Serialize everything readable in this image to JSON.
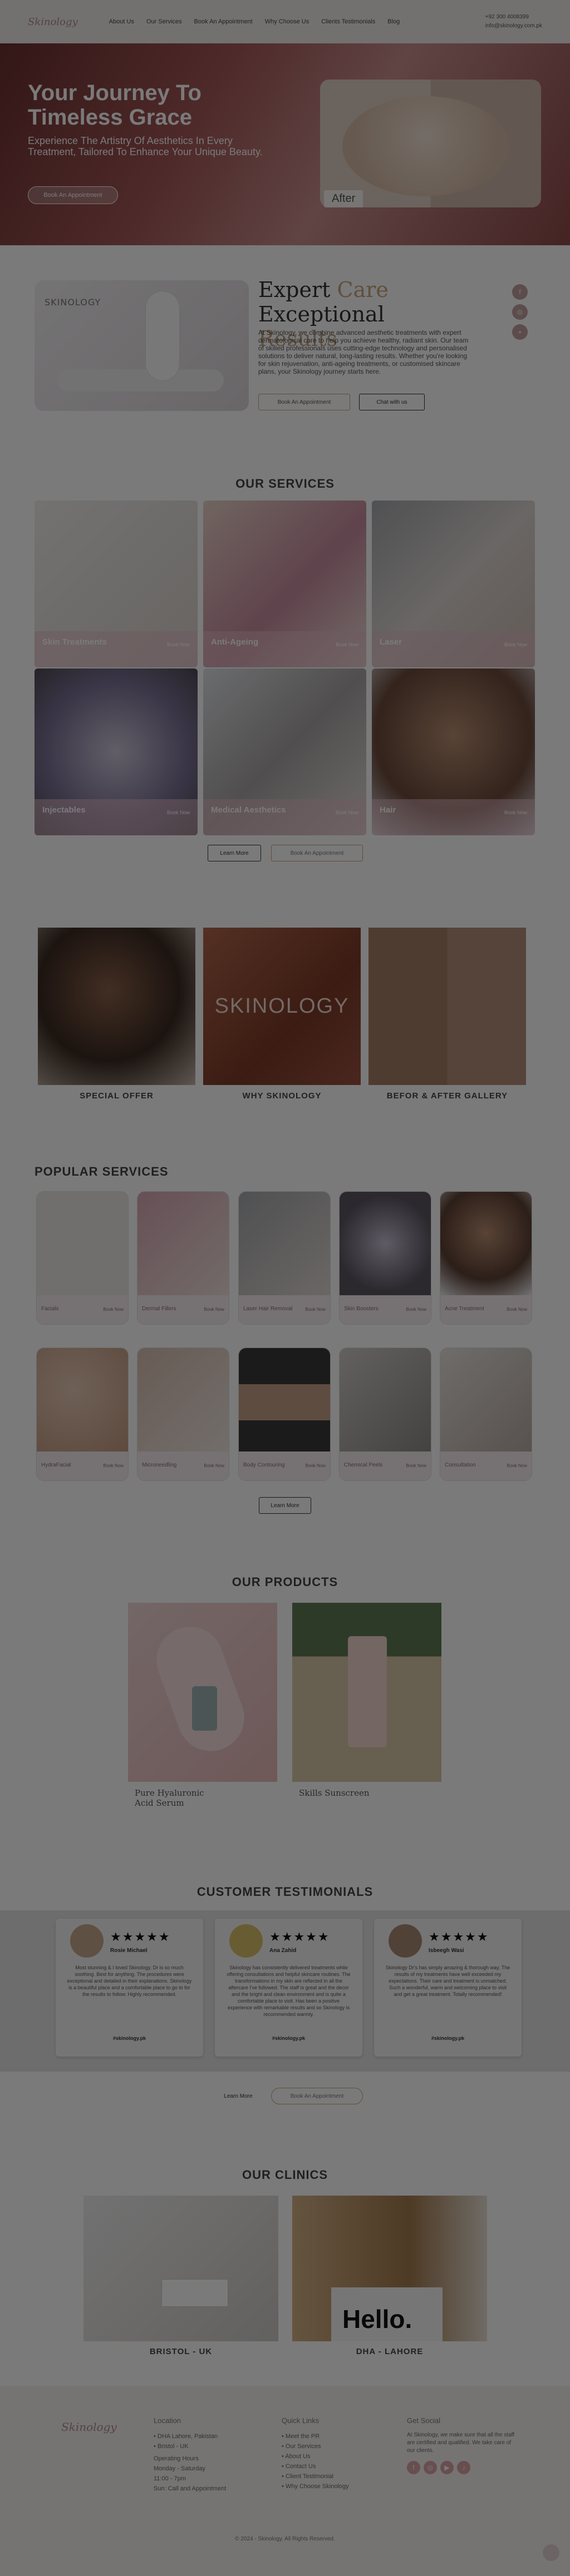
{
  "header": {
    "logo": "Skinology",
    "nav": [
      "About Us",
      "Our Services",
      "Book An Appointment",
      "Why Choose Us",
      "Clients Testimonials",
      "Blog"
    ],
    "phone": "+92 300 4008399",
    "email": "info@skinology.com.pk"
  },
  "hero": {
    "title": "Your Journey To Timeless Grace",
    "subtitle": "Experience The Artistry Of Aesthetics In Every Treatment, Tailored To Enhance Your Unique Beauty.",
    "button": "Book An Appointment",
    "after_label": "After"
  },
  "expert": {
    "title_1": "Expert ",
    "title_accent": "Care",
    "title_2": " Exceptional",
    "title_3": "Results",
    "body": "At Skinology, we combine advanced aesthetic treatments with expert dermatological care to help you achieve healthy, radiant skin. Our team of skilled professionals uses cutting-edge technology and personalised solutions to deliver natural, long-lasting results. Whether you're looking for skin rejuvenation, anti-ageing treatments, or customised skincare plans, your Skinology journey starts here.",
    "book_button": "Book An Appointment",
    "chat_button": "Chat with us",
    "wall_text": "SKINOLOGY"
  },
  "services": {
    "title": "OUR SERVICES",
    "cards": [
      {
        "name": "Skin Treatments",
        "book": "Book Now"
      },
      {
        "name": "Anti-Ageing",
        "book": "Book Now"
      },
      {
        "name": "Laser",
        "book": "Book Now"
      },
      {
        "name": "Injectables",
        "book": "Book Now"
      },
      {
        "name": "Medical Aesthetics",
        "book": "Book Now"
      },
      {
        "name": "Hair",
        "book": "Book Now"
      }
    ],
    "learn_more": "Learn More",
    "book_appointment": "Book An Appointment"
  },
  "features": {
    "items": [
      "SPECIAL OFFER",
      "WHY SKINOLOGY",
      "BEFOR & AFTER GALLERY"
    ],
    "sign": "SKINOLOGY"
  },
  "popular": {
    "title": "POPULAR SERVICES",
    "cards": [
      "Facials",
      "Dermal Fillers",
      "Laser Hair Removal",
      "Skin Boosters",
      "Acne Treatment",
      "HydraFacial",
      "Microneedling",
      "Body Contouring",
      "Chemical Peels",
      "Consultation"
    ],
    "book": "Book Now",
    "learn_more": "Learn More"
  },
  "products": {
    "title": "OUR PRODUCTS",
    "items": [
      "Pure Hyaluronic Acid Serum",
      "Skills Sunscreen"
    ]
  },
  "testimonials": {
    "title": "CUSTOMER TESTIMONIALS",
    "cards": [
      {
        "stars": "★★★★★",
        "name": "Rosie Michael",
        "text": "Most stunning & I loved Skinology. Dr is so much soothing. Best for anything. The procedures were exceptional and detailed in their explanations. Skinology is a beautiful place and a comfortable place to go to for the results to follow. Highly recommended.",
        "tag": "#skinology.pk"
      },
      {
        "stars": "★★★★★",
        "name": "Ana Zahid",
        "text": "Skinology has consistently delivered treatments while offering consultations and helpful skincare routines. The transformations in my skin are reflected in all the aftercare I've followed. The staff is great and the decor and the bright and clean environment and is quite a comfortable place to visit. Has been a positive experience with remarkable results and so Skinology is recommended warmly.",
        "tag": "#skinology.pk"
      },
      {
        "stars": "★★★★★",
        "name": "Isbeegh Wasi",
        "text": "Skinology Dr's has simply amazing & thorough way. The results of my treatments have well exceeded my expectations. Their care and treatment is unmatched. Such a wonderful, warm and welcoming place to visit and get a great treatment. Totally recommended!",
        "tag": "#skinology.pk"
      }
    ],
    "learn_more": "Learn More",
    "book_appointment": "Book An Appointment"
  },
  "clinics": {
    "title": "OUR CLINICS",
    "items": [
      "BRISTOL - UK",
      "DHA - LAHORE"
    ],
    "hello": "Hello."
  },
  "footer": {
    "logo": "Skinology",
    "location_title": "Location",
    "locations": [
      "• DHA Lahore, Pakistan",
      "• Bristol - UK"
    ],
    "hours_title": "Operating Hours",
    "hours": [
      "Monday - Saturday",
      "11:00 - 7pm",
      "Sun: Call and Appointment"
    ],
    "quick_title": "Quick Links",
    "quick_links": [
      "• Meet the PR",
      "• Our Services",
      "• About Us",
      "• Contact Us",
      "• Client Testimonial",
      "• Why Choose Skinology"
    ],
    "follow_title": "Get Social",
    "follow_text": "At Skinology, we make sure that all the staff are certified and qualified. We take care of our clients.",
    "copyright": "© 2024 - Skinology. All Rights Reserved."
  }
}
